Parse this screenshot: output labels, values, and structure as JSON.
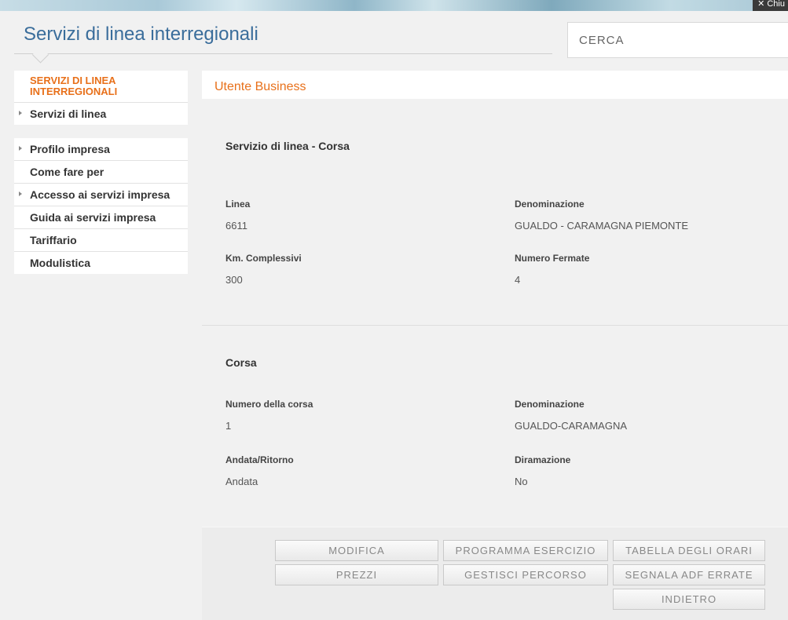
{
  "header": {
    "title": "Servizi di linea interregionali",
    "close_label": "✕ Chiu",
    "search_placeholder": "CERCA"
  },
  "sidebar": {
    "section_title": "SERVIZI DI LINEA INTERREGIONALI",
    "group1": [
      {
        "label": "Servizi di linea",
        "arrow": true
      }
    ],
    "group2": [
      {
        "label": "Profilo impresa",
        "arrow": true
      },
      {
        "label": "Come fare per",
        "arrow": false
      },
      {
        "label": "Accesso ai servizi impresa",
        "arrow": true
      },
      {
        "label": "Guida ai servizi impresa",
        "arrow": false
      },
      {
        "label": "Tariffario",
        "arrow": false
      },
      {
        "label": "Modulistica",
        "arrow": false
      }
    ]
  },
  "main": {
    "header": "Utente Business",
    "linea_section": {
      "title": "Servizio di linea - Corsa",
      "fields": {
        "linea_label": "Linea",
        "linea_value": "6611",
        "denominazione_label": "Denominazione",
        "denominazione_value": "GUALDO - CARAMAGNA PIEMONTE",
        "km_label": "Km. Complessivi",
        "km_value": "300",
        "fermate_label": "Numero Fermate",
        "fermate_value": "4"
      }
    },
    "corsa_section": {
      "title": "Corsa",
      "fields": {
        "numero_label": "Numero della corsa",
        "numero_value": "1",
        "denominazione_label": "Denominazione",
        "denominazione_value": "GUALDO-CARAMAGNA",
        "andata_label": "Andata/Ritorno",
        "andata_value": "Andata",
        "diramazione_label": "Diramazione",
        "diramazione_value": "No"
      }
    },
    "buttons": {
      "modifica": "MODIFICA",
      "programma": "PROGRAMMA ESERCIZIO",
      "tabella": "TABELLA DEGLI ORARI",
      "prezzi": "PREZZI",
      "percorso": "GESTISCI PERCORSO",
      "segnala": "SEGNALA ADF ERRATE",
      "indietro": "INDIETRO"
    }
  }
}
